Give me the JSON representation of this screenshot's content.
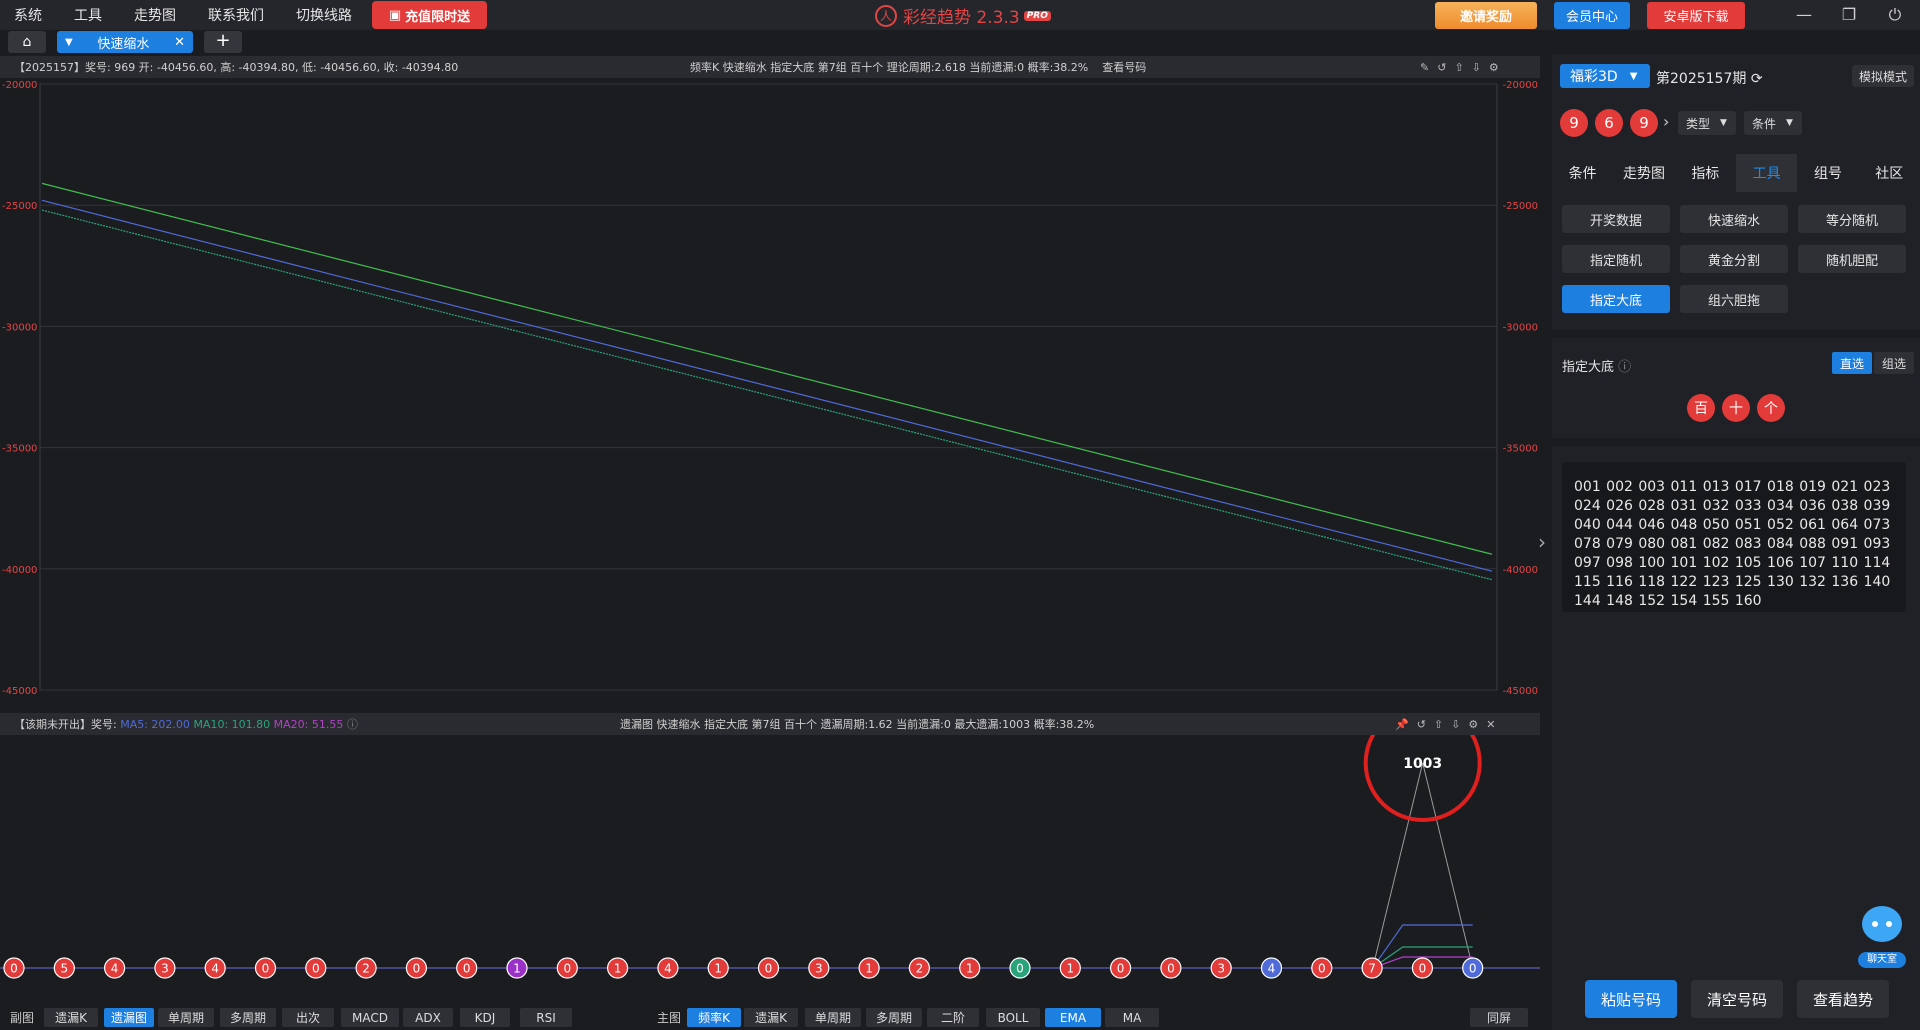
{
  "menu": [
    "系统",
    "工具",
    "走势图",
    "联系我们",
    "切换线路"
  ],
  "promo": {
    "label": "充值限时送",
    "icon": "gift-icon"
  },
  "app": {
    "title": "彩经趋势 2.3.3",
    "badge": "PRO"
  },
  "top_buttons": {
    "invite": "邀请奖励",
    "vip": "会员中心",
    "android": "安卓版下载"
  },
  "window_controls": [
    "minimize-icon",
    "restore-icon",
    "power-icon"
  ],
  "tabs": {
    "active": "快速缩水",
    "home_icon": "home-icon",
    "add_icon": "plus-icon"
  },
  "chart1": {
    "header_left": "【2025157】奖号: 969   开: -40456.60,  高: -40394.80,  低: -40456.60,  收: -40394.80",
    "header_mid": "频率K   快速缩水   指定大底 第7组   百十个   理论周期:2.618   当前遗漏:0   概率:38.2%",
    "header_link": "查看号码",
    "toolbar_icons": [
      "edit-icon",
      "back-icon",
      "up-icon",
      "down-icon",
      "settings-icon"
    ]
  },
  "chart2": {
    "header_left_prefix": "【该期未开出】奖号:",
    "ma5": "MA5: 202.00",
    "ma10": "MA10: 101.80",
    "ma20": "MA20: 51.55",
    "header_mid": "遗漏图   快速缩水   指定大底 第7组   百十个   遗漏周期:1.62   当前遗漏:0   最大遗漏:1003   概率:38.2%",
    "annotation": "1003",
    "colors": {
      "ma5": "#4f6bd9",
      "ma10": "#2aa37a",
      "ma20": "#b340c9"
    }
  },
  "chart_data": [
    {
      "type": "line",
      "ylim": [
        -45000,
        -20000
      ],
      "yticks": [
        -20000,
        -25000,
        -30000,
        -35000,
        -40000,
        -45000
      ],
      "ytick_labels": [
        "-20000",
        "-25000",
        "-30000",
        "-35000",
        "-40000",
        "-45000"
      ],
      "series": [
        {
          "color": "#3fbf4f",
          "values": [
            -24100,
            -39400
          ]
        },
        {
          "color": "#4f6bd9",
          "values": [
            -24800,
            -40100
          ]
        },
        {
          "color": "#2aa37a",
          "values": [
            -25200,
            -40450
          ]
        }
      ]
    },
    {
      "type": "scatter",
      "values": [
        0,
        5,
        4,
        3,
        4,
        0,
        0,
        2,
        0,
        0,
        1,
        0,
        1,
        4,
        1,
        0,
        3,
        1,
        2,
        1,
        0,
        1,
        0,
        0,
        3,
        4,
        0,
        7,
        0,
        0
      ],
      "ball_colors": [
        "#e33a3a",
        "#e33a3a",
        "#e33a3a",
        "#e33a3a",
        "#e33a3a",
        "#e33a3a",
        "#e33a3a",
        "#e33a3a",
        "#e33a3a",
        "#e33a3a",
        "#9b30c9",
        "#e33a3a",
        "#e33a3a",
        "#e33a3a",
        "#e33a3a",
        "#e33a3a",
        "#e33a3a",
        "#e33a3a",
        "#e33a3a",
        "#e33a3a",
        "#2aa37a",
        "#e33a3a",
        "#e33a3a",
        "#e33a3a",
        "#e33a3a",
        "#4f6bd9",
        "#e33a3a",
        "#e33a3a",
        "#e33a3a",
        "#4f6bd9"
      ],
      "peak": 1003
    }
  ],
  "bottombar": {
    "sub_label": "副图",
    "sub_buttons": [
      "遗漏K",
      "遗漏图",
      "单周期",
      "多周期",
      "出次",
      "MACD",
      "ADX",
      "KDJ",
      "RSI"
    ],
    "sub_active": "遗漏图",
    "main_label": "主图",
    "main_buttons": [
      "频率K",
      "遗漏K",
      "单周期",
      "多周期",
      "二阶",
      "BOLL",
      "EMA",
      "MA"
    ],
    "main_active": [
      "频率K",
      "EMA"
    ],
    "sync": "同屏"
  },
  "sidebar": {
    "lottery": "福彩3D",
    "issue": "第2025157期",
    "mode": "模拟模式",
    "balls": [
      "9",
      "6",
      "9"
    ],
    "type_dd": "类型",
    "cond_dd": "条件",
    "tabs": [
      "条件",
      "走势图",
      "指标",
      "工具",
      "组号",
      "社区"
    ],
    "active_tab": "工具",
    "tools": [
      "开奖数据",
      "快速缩水",
      "等分随机",
      "指定随机",
      "黄金分割",
      "随机胆配",
      "指定大底",
      "组六胆拖"
    ],
    "active_tool": "指定大底",
    "section_label": "指定大底",
    "seg_direct": "直选",
    "seg_group": "组选",
    "positions": [
      "百",
      "十",
      "个"
    ],
    "numbers": "001 002 003 011 013 017 018 019 021 023 024 026 028 031 032 033 034 036 038 039 040 044 046 048 050 051 052 061 064 073 078 079 080 081 082 083 084 088 091 093 097 098 100 101 102 105 106 107 110 114 115 116 118 122 123 125 130 132 136 140 144 148 152 154 155 160",
    "actions": {
      "paste": "粘贴号码",
      "clear": "清空号码",
      "trend": "查看趋势"
    },
    "chat": "聊天室"
  }
}
